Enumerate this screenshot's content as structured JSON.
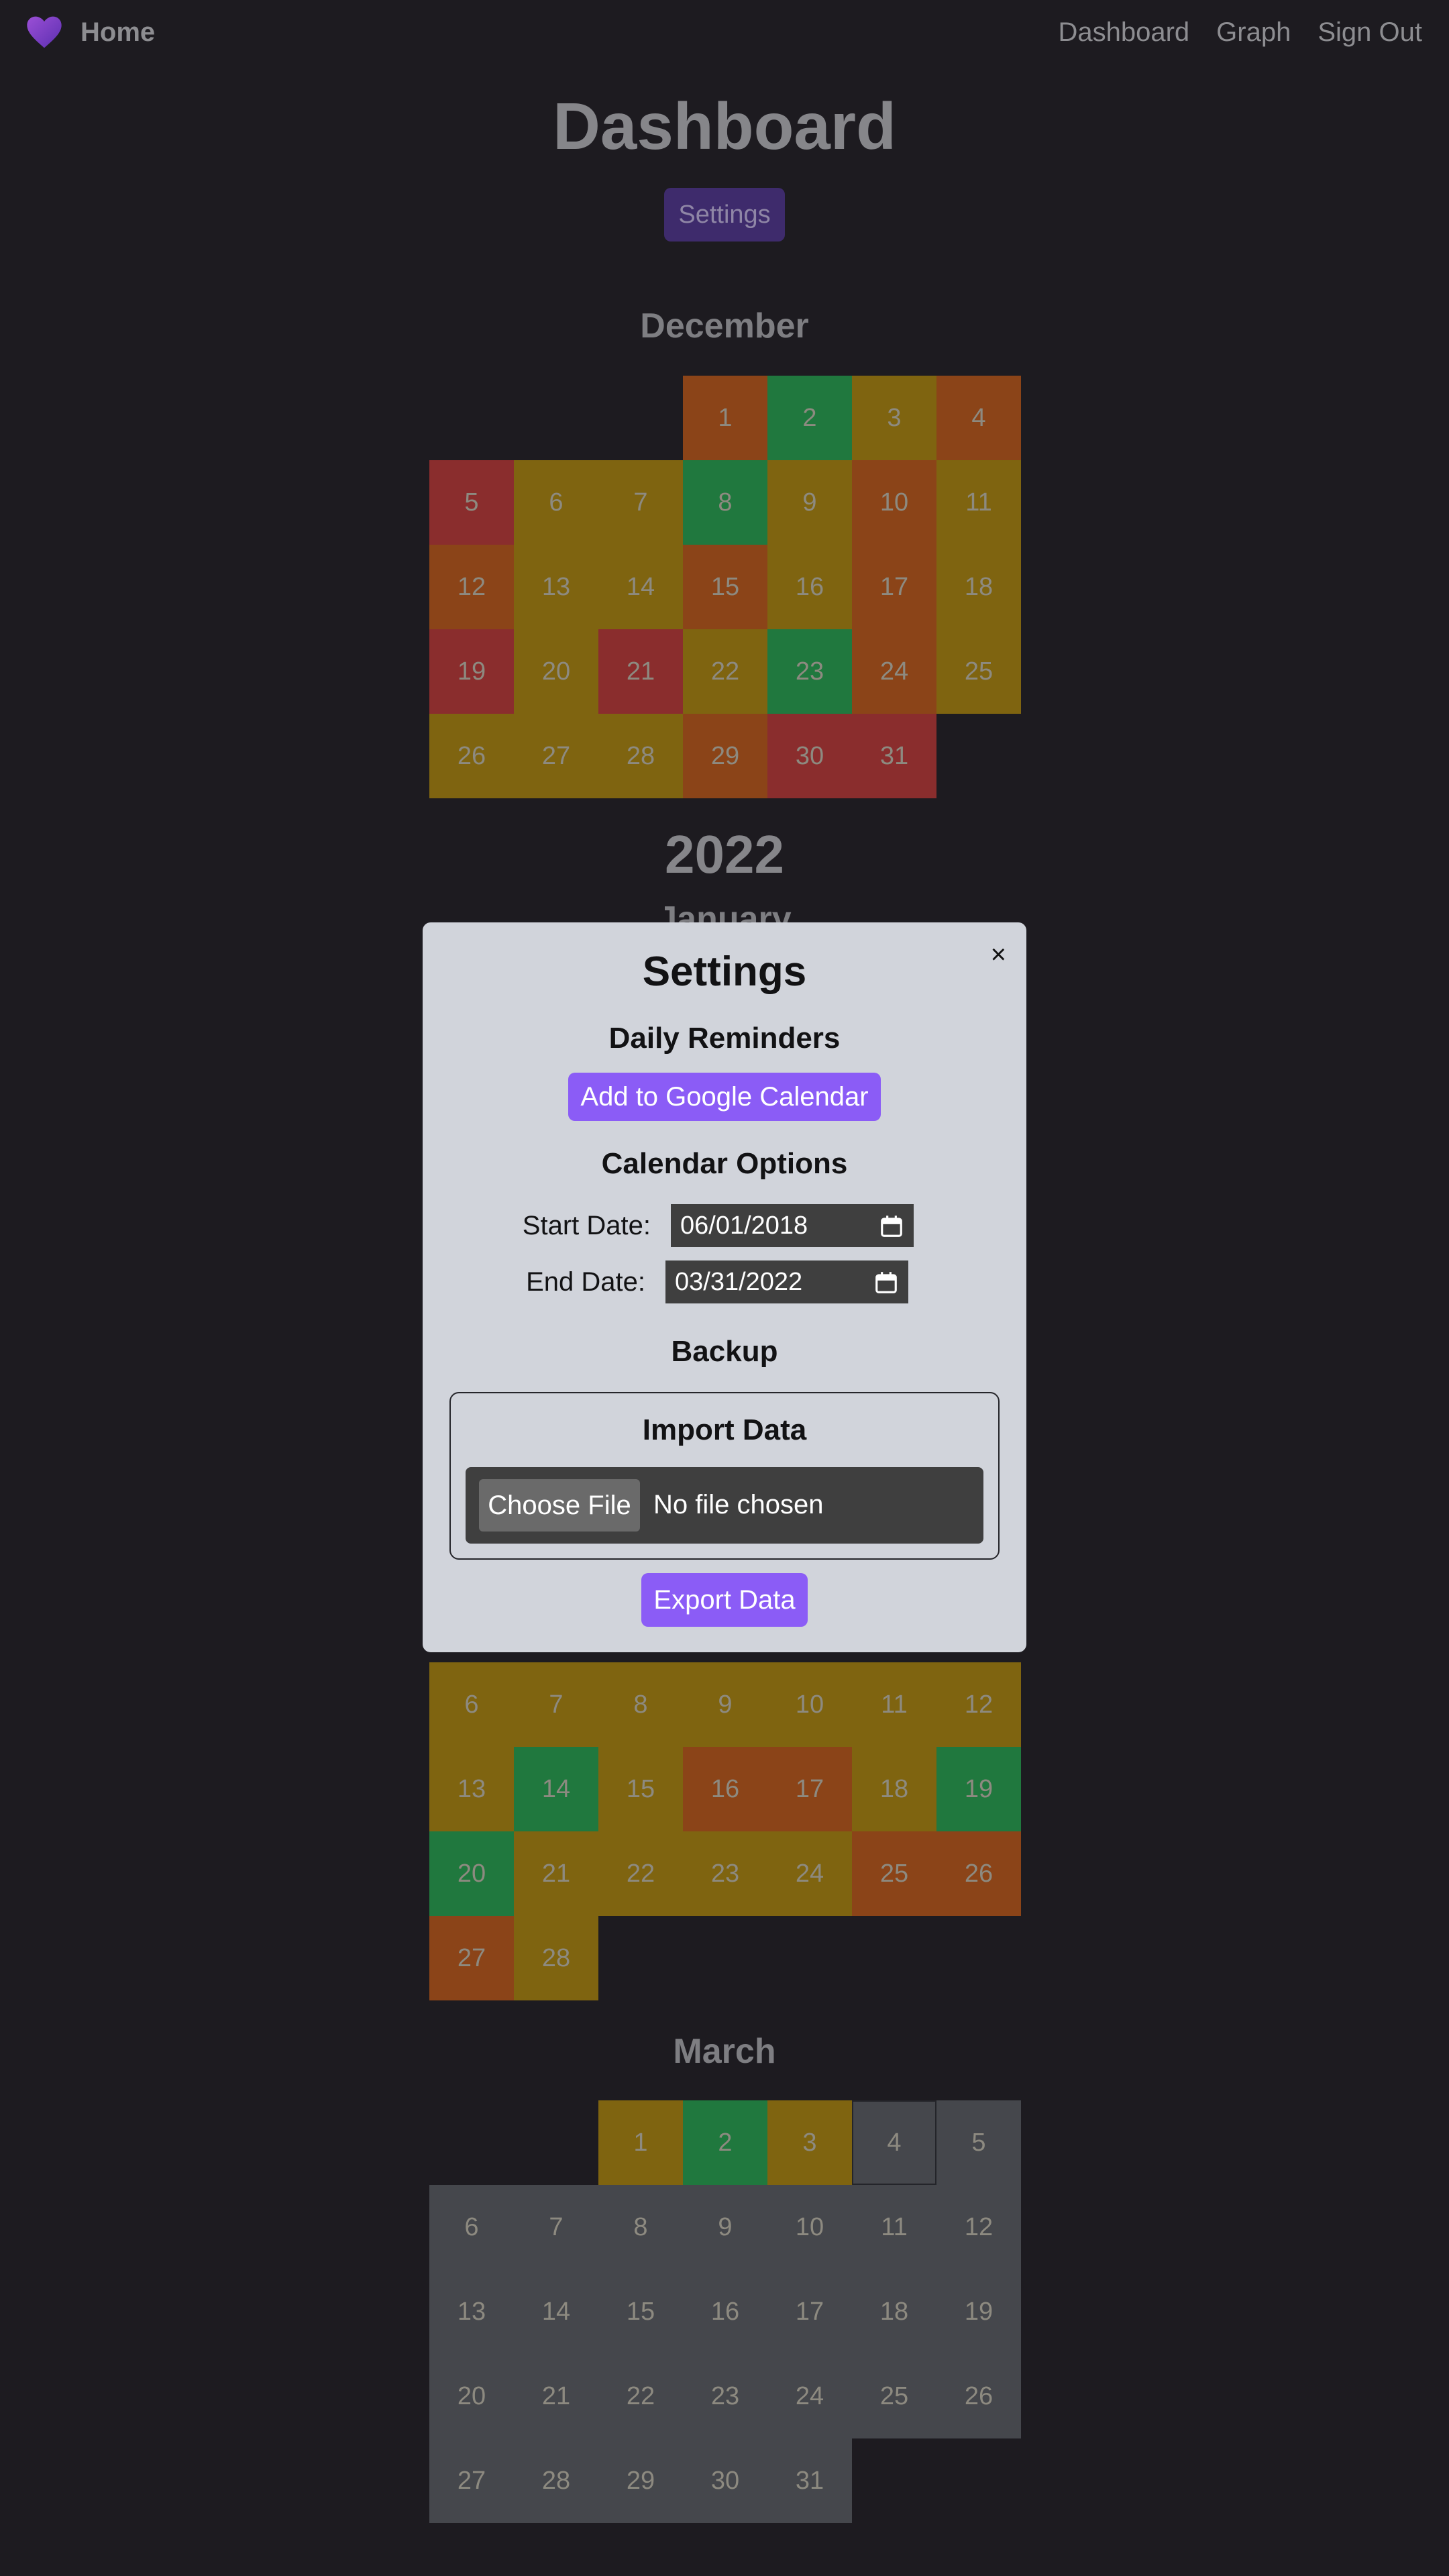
{
  "nav": {
    "brand": "Home",
    "links": [
      "Dashboard",
      "Graph",
      "Sign Out"
    ]
  },
  "page": {
    "title": "Dashboard",
    "settings_button": "Settings"
  },
  "calendar": {
    "december": {
      "name": "December",
      "colors": [
        "org",
        "grn",
        "yel",
        "org",
        "red",
        "yel",
        "yel",
        "grn",
        "yel",
        "org",
        "yel",
        "org",
        "yel",
        "yel",
        "org",
        "yel",
        "org",
        "yel",
        "red",
        "yel",
        "red",
        "yel",
        "grn",
        "org",
        "yel",
        "yel",
        "yel",
        "yel",
        "org",
        "red",
        "red"
      ]
    },
    "year": "2022",
    "january": {
      "name": "January"
    },
    "february": {
      "days": [
        "6",
        "7",
        "8",
        "9",
        "10",
        "11",
        "12",
        "13",
        "14",
        "15",
        "16",
        "17",
        "18",
        "19",
        "20",
        "21",
        "22",
        "23",
        "24",
        "25",
        "26",
        "27",
        "28"
      ],
      "colors": [
        "yel",
        "yel",
        "yel",
        "yel",
        "yel",
        "yel",
        "yel",
        "yel",
        "grn",
        "yel",
        "org",
        "org",
        "yel",
        "grn",
        "grn",
        "yel",
        "yel",
        "yel",
        "yel",
        "org",
        "org",
        "org",
        "yel"
      ]
    },
    "march": {
      "name": "March",
      "colors": [
        "yel",
        "grn",
        "yel",
        "gsel",
        "gry",
        "gry",
        "gry",
        "gry",
        "gry",
        "gry",
        "gry",
        "gry",
        "gry",
        "gry",
        "gry",
        "gry",
        "gry",
        "gry",
        "gry",
        "gry",
        "gry",
        "gry",
        "gry",
        "gry",
        "gry",
        "gry",
        "gry",
        "gry",
        "gry",
        "gry",
        "gry"
      ]
    }
  },
  "colors": {
    "yel": "#7f6410",
    "org": "#8b4418",
    "red": "#8a2d2d",
    "grn": "#20783e",
    "gry": "#45474c",
    "accent": "#8b5cf6"
  },
  "settings_modal": {
    "title": "Settings",
    "close": "×",
    "daily_reminders": "Daily Reminders",
    "add_google": "Add to Google Calendar",
    "calendar_options": "Calendar Options",
    "start_label": "Start Date:",
    "start_value": "06/01/2018",
    "end_label": "End Date:",
    "end_value": "03/31/2022",
    "backup": "Backup",
    "import_title": "Import Data",
    "choose_file": "Choose File",
    "no_file": "No file chosen",
    "export": "Export Data"
  }
}
